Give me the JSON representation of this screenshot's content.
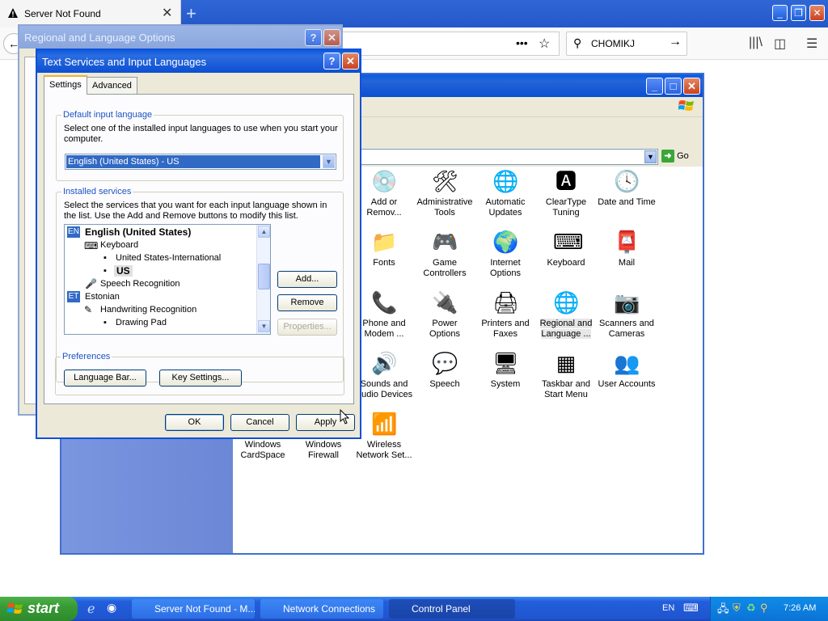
{
  "browser": {
    "tab_title": "Server Not Found",
    "search_value": "CHOMIKJ",
    "new_tab_label": "+"
  },
  "control_panel": {
    "go_label": "Go",
    "items": [
      {
        "label": "Add or\nRemov...",
        "icon": "add-remove-programs-icon"
      },
      {
        "label": "Administrative\nTools",
        "icon": "administrative-tools-icon"
      },
      {
        "label": "Automatic\nUpdates",
        "icon": "automatic-updates-icon"
      },
      {
        "label": "ClearType\nTuning",
        "icon": "cleartype-icon"
      },
      {
        "label": "Date and Time",
        "icon": "date-time-icon"
      },
      {
        "label": "Fonts",
        "icon": "fonts-icon"
      },
      {
        "label": "Game\nControllers",
        "icon": "game-controllers-icon"
      },
      {
        "label": "Internet\nOptions",
        "icon": "internet-options-icon"
      },
      {
        "label": "Keyboard",
        "icon": "keyboard-icon"
      },
      {
        "label": "Mail",
        "icon": "mail-icon"
      },
      {
        "label": "Phone and\nModem ...",
        "icon": "phone-modem-icon"
      },
      {
        "label": "Power Options",
        "icon": "power-options-icon"
      },
      {
        "label": "Printers and\nFaxes",
        "icon": "printers-icon"
      },
      {
        "label": "Regional and\nLanguage ...",
        "icon": "regional-language-icon"
      },
      {
        "label": "Scanners and\nCameras",
        "icon": "scanners-icon"
      },
      {
        "label": "Sounds and\nAudio Devices",
        "icon": "sounds-icon"
      },
      {
        "label": "Speech",
        "icon": "speech-icon"
      },
      {
        "label": "System",
        "icon": "system-icon"
      },
      {
        "label": "Taskbar and\nStart Menu",
        "icon": "taskbar-icon"
      },
      {
        "label": "User Accounts",
        "icon": "user-accounts-icon"
      },
      {
        "label": "Windows\nCardSpace",
        "icon": "cardspace-icon"
      },
      {
        "label": "Windows\nFirewall",
        "icon": "firewall-icon"
      },
      {
        "label": "Wireless\nNetwork Set...",
        "icon": "wireless-icon"
      }
    ]
  },
  "regional_dialog": {
    "title": "Regional and Language Options"
  },
  "text_services": {
    "title": "Text Services and Input Languages",
    "tabs": [
      "Settings",
      "Advanced"
    ],
    "default_group": "Default input language",
    "default_desc": "Select one of the installed input languages to use when you start your computer.",
    "default_value": "English (United States) - US",
    "installed_group": "Installed services",
    "installed_desc": "Select the services that you want for each input language shown in the list. Use the Add and Remove buttons to modify this list.",
    "list": {
      "en_badge": "EN",
      "en_lang": "English (United States)",
      "keyboard": "Keyboard",
      "us_intl": "United States-International",
      "us": "US",
      "speech": "Speech Recognition",
      "et_badge": "ET",
      "et_lang": "Estonian",
      "handwriting": "Handwriting Recognition",
      "drawing_pad": "Drawing Pad"
    },
    "add_label": "Add...",
    "remove_label": "Remove",
    "properties_label": "Properties...",
    "pref_group": "Preferences",
    "language_bar_label": "Language Bar...",
    "key_settings_label": "Key Settings...",
    "ok_label": "OK",
    "cancel_label": "Cancel",
    "apply_label": "Apply"
  },
  "taskbar": {
    "start_label": "start",
    "tasks": [
      "Server Not Found - M...",
      "Network Connections",
      "Control Panel"
    ],
    "lang": "EN",
    "clock": "7:26 AM"
  }
}
